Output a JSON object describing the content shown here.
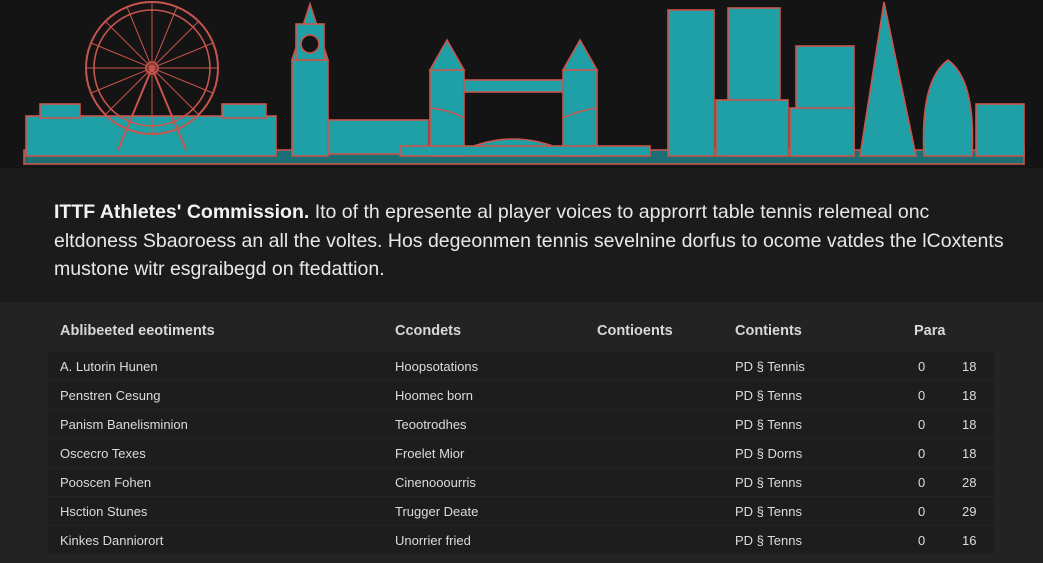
{
  "intro": {
    "lead": "ITTF Athletes' Commission.",
    "body": " Ito of th epresente al player voices to approrrt table tennis relemeal onc eltdoness Sbaoroess an all the voltes. Hos degeonmen tennis sevelnine dorfus to ocome vatdes the lCoxtents mustone witr esgraibegd on ftedattion."
  },
  "table": {
    "headers": {
      "name": "Ablibeeted eeotiments",
      "conduct": "Ccondets",
      "continents_a": "Contioents",
      "continents_b": "Contients",
      "para": "Para"
    },
    "rows": [
      {
        "name": "A. Lutorin Hunen",
        "conduct": "Hoopsotations",
        "cont": "PD § Tennis",
        "a": "0",
        "b": "18"
      },
      {
        "name": "Penstren Cesung",
        "conduct": "Hoomec born",
        "cont": "PD § Tenns",
        "a": "0",
        "b": "18"
      },
      {
        "name": "Panism Banelisminion",
        "conduct": "Teootrodhes",
        "cont": "PD § Tenns",
        "a": "0",
        "b": "18"
      },
      {
        "name": "Oscecro Texes",
        "conduct": "Froelet Mior",
        "cont": "PD § Dorns",
        "a": "0",
        "b": "18"
      },
      {
        "name": "Pooscen Fohen",
        "conduct": "Cinenooourris",
        "cont": "PD § Tenns",
        "a": "0",
        "b": "28"
      },
      {
        "name": "Hsction Stunes",
        "conduct": "Trugger Deate",
        "cont": "PD § Tenns",
        "a": "0",
        "b": "29"
      },
      {
        "name": "Kinkes Danniorort",
        "conduct": "Unorrier fried",
        "cont": "PD § Tenns",
        "a": "0",
        "b": "16"
      }
    ]
  },
  "colors": {
    "outline_red": "#c8554d",
    "fill_teal": "#1fa0a6",
    "bg": "#1a1a1a"
  }
}
